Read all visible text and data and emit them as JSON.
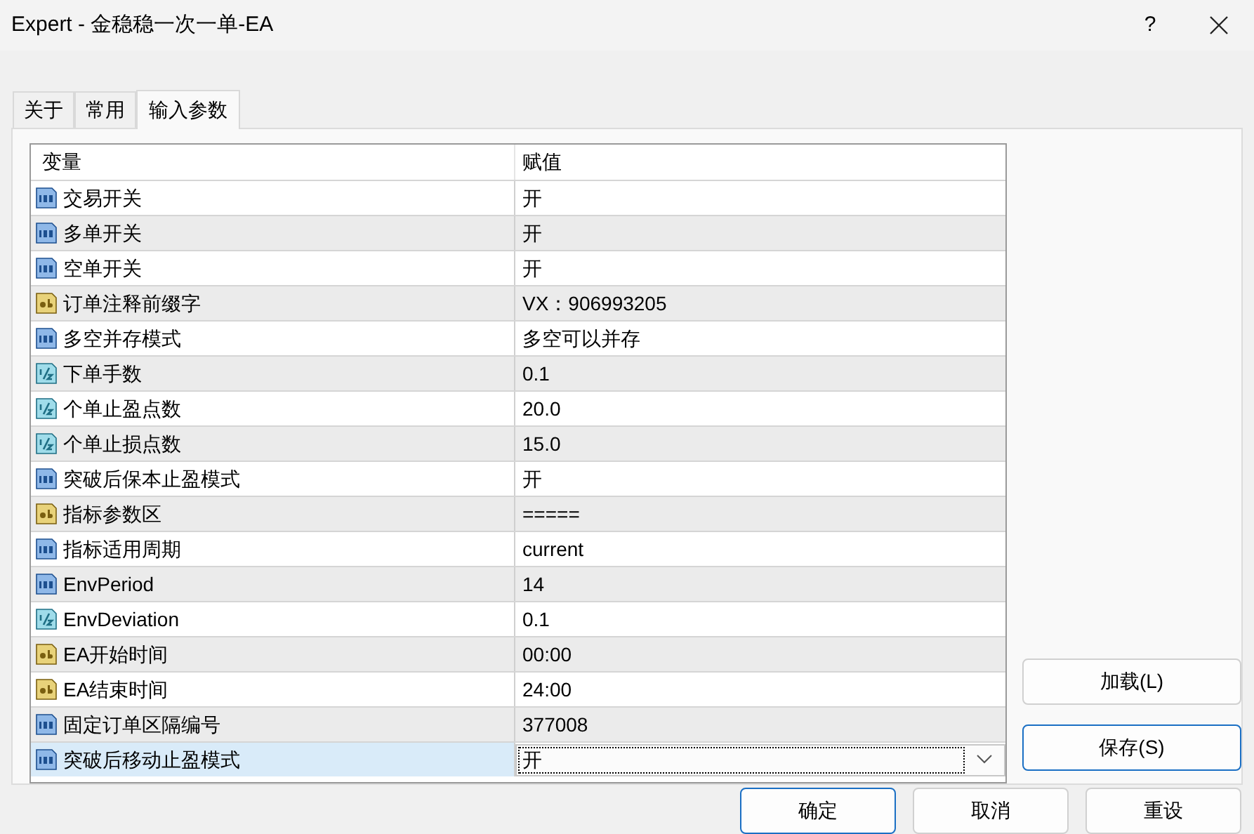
{
  "window": {
    "title": "Expert - 金稳稳一次一单-EA",
    "help": "?"
  },
  "tabs": [
    {
      "label": "关于",
      "selected": false
    },
    {
      "label": "常用",
      "selected": false
    },
    {
      "label": "输入参数",
      "selected": true
    }
  ],
  "table": {
    "columns": [
      "变量",
      "赋值"
    ],
    "rows": [
      {
        "kind": "int",
        "name": "交易开关",
        "value": "开",
        "selected": false
      },
      {
        "kind": "int",
        "name": "多单开关",
        "value": "开",
        "selected": false
      },
      {
        "kind": "int",
        "name": "空单开关",
        "value": "开",
        "selected": false
      },
      {
        "kind": "string",
        "name": "订单注释前缀字",
        "value": "VX：906993205",
        "selected": false
      },
      {
        "kind": "int",
        "name": "多空并存模式",
        "value": "多空可以并存",
        "selected": false
      },
      {
        "kind": "double",
        "name": "下单手数",
        "value": "0.1",
        "selected": false
      },
      {
        "kind": "double",
        "name": "个单止盈点数",
        "value": "20.0",
        "selected": false
      },
      {
        "kind": "double",
        "name": "个单止损点数",
        "value": "15.0",
        "selected": false
      },
      {
        "kind": "int",
        "name": "突破后保本止盈模式",
        "value": "开",
        "selected": false
      },
      {
        "kind": "string",
        "name": "指标参数区",
        "value": "=====",
        "selected": false
      },
      {
        "kind": "int",
        "name": "指标适用周期",
        "value": "current",
        "selected": false
      },
      {
        "kind": "int",
        "name": "EnvPeriod",
        "value": "14",
        "selected": false
      },
      {
        "kind": "double",
        "name": "EnvDeviation",
        "value": "0.1",
        "selected": false
      },
      {
        "kind": "string",
        "name": "EA开始时间",
        "value": "00:00",
        "selected": false
      },
      {
        "kind": "string",
        "name": "EA结束时间",
        "value": "24:00",
        "selected": false
      },
      {
        "kind": "int",
        "name": "固定订单区隔编号",
        "value": "377008",
        "selected": false
      },
      {
        "kind": "int",
        "name": "突破后移动止盈模式",
        "value": "开",
        "selected": true
      }
    ]
  },
  "side_buttons": [
    {
      "label": "加载(L)"
    },
    {
      "label": "保存(S)"
    }
  ],
  "buttons": [
    {
      "label": "确定"
    },
    {
      "label": "取消"
    },
    {
      "label": "重设"
    }
  ]
}
